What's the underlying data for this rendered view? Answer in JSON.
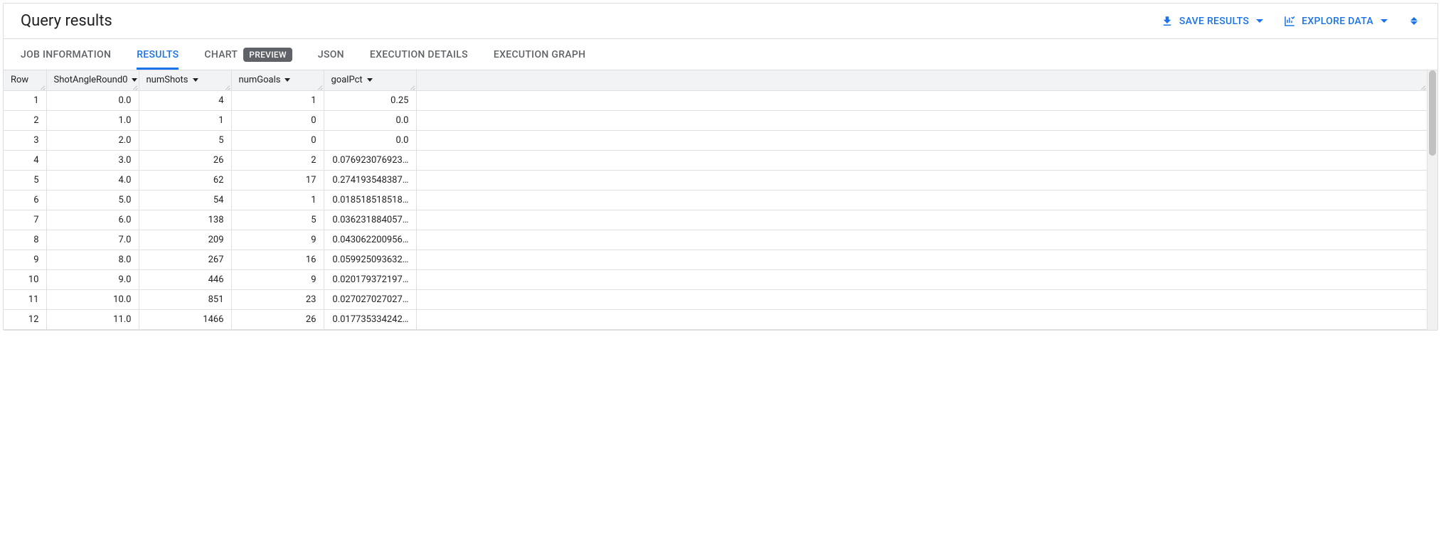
{
  "header": {
    "title": "Query results",
    "save_results_label": "SAVE RESULTS",
    "explore_data_label": "EXPLORE DATA"
  },
  "tabs": [
    {
      "id": "job",
      "label": "JOB INFORMATION",
      "active": false
    },
    {
      "id": "results",
      "label": "RESULTS",
      "active": true
    },
    {
      "id": "chart",
      "label": "CHART",
      "active": false,
      "badge": "PREVIEW"
    },
    {
      "id": "json",
      "label": "JSON",
      "active": false
    },
    {
      "id": "execdetails",
      "label": "EXECUTION DETAILS",
      "active": false
    },
    {
      "id": "execgraph",
      "label": "EXECUTION GRAPH",
      "active": false
    }
  ],
  "columns": [
    {
      "key": "row",
      "label": "Row",
      "sortable": false
    },
    {
      "key": "ShotAngleRound0",
      "label": "ShotAngleRound0",
      "sortable": true
    },
    {
      "key": "numShots",
      "label": "numShots",
      "sortable": true
    },
    {
      "key": "numGoals",
      "label": "numGoals",
      "sortable": true
    },
    {
      "key": "goalPct",
      "label": "goalPct",
      "sortable": true
    }
  ],
  "rows": [
    {
      "row": "1",
      "ShotAngleRound0": "0.0",
      "numShots": "4",
      "numGoals": "1",
      "goalPct": "0.25"
    },
    {
      "row": "2",
      "ShotAngleRound0": "1.0",
      "numShots": "1",
      "numGoals": "0",
      "goalPct": "0.0"
    },
    {
      "row": "3",
      "ShotAngleRound0": "2.0",
      "numShots": "5",
      "numGoals": "0",
      "goalPct": "0.0"
    },
    {
      "row": "4",
      "ShotAngleRound0": "3.0",
      "numShots": "26",
      "numGoals": "2",
      "goalPct": "0.076923076923…"
    },
    {
      "row": "5",
      "ShotAngleRound0": "4.0",
      "numShots": "62",
      "numGoals": "17",
      "goalPct": "0.274193548387…"
    },
    {
      "row": "6",
      "ShotAngleRound0": "5.0",
      "numShots": "54",
      "numGoals": "1",
      "goalPct": "0.018518518518…"
    },
    {
      "row": "7",
      "ShotAngleRound0": "6.0",
      "numShots": "138",
      "numGoals": "5",
      "goalPct": "0.036231884057…"
    },
    {
      "row": "8",
      "ShotAngleRound0": "7.0",
      "numShots": "209",
      "numGoals": "9",
      "goalPct": "0.043062200956…"
    },
    {
      "row": "9",
      "ShotAngleRound0": "8.0",
      "numShots": "267",
      "numGoals": "16",
      "goalPct": "0.059925093632…"
    },
    {
      "row": "10",
      "ShotAngleRound0": "9.0",
      "numShots": "446",
      "numGoals": "9",
      "goalPct": "0.020179372197…"
    },
    {
      "row": "11",
      "ShotAngleRound0": "10.0",
      "numShots": "851",
      "numGoals": "23",
      "goalPct": "0.027027027027…"
    },
    {
      "row": "12",
      "ShotAngleRound0": "11.0",
      "numShots": "1466",
      "numGoals": "26",
      "goalPct": "0.017735334242…"
    }
  ]
}
